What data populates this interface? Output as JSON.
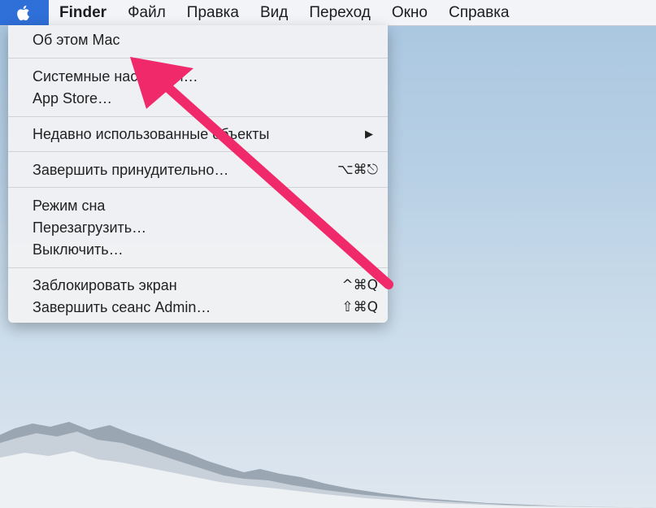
{
  "menubar": {
    "apple_icon": "apple-logo-icon",
    "items": [
      {
        "label": "Finder",
        "bold": true
      },
      {
        "label": "Файл"
      },
      {
        "label": "Правка"
      },
      {
        "label": "Вид"
      },
      {
        "label": "Переход"
      },
      {
        "label": "Окно"
      },
      {
        "label": "Справка"
      }
    ]
  },
  "apple_menu": {
    "items": {
      "about": "Об этом Mac",
      "system_prefs": "Системные настройки…",
      "app_store": "App Store…",
      "recent": "Недавно использованные объекты",
      "recent_arrow": "▶",
      "force_quit": "Завершить принудительно…",
      "force_quit_shortcut": "⌥⌘⎋",
      "sleep": "Режим сна",
      "restart": "Перезагрузить…",
      "shutdown": "Выключить…",
      "lock": "Заблокировать экран",
      "lock_shortcut": "^⌘Q",
      "logout": "Завершить сеанс Admin…",
      "logout_shortcut": "⇧⌘Q"
    }
  },
  "colors": {
    "apple_highlight": "#2f6fd8",
    "annotation_arrow": "#f0296b"
  }
}
